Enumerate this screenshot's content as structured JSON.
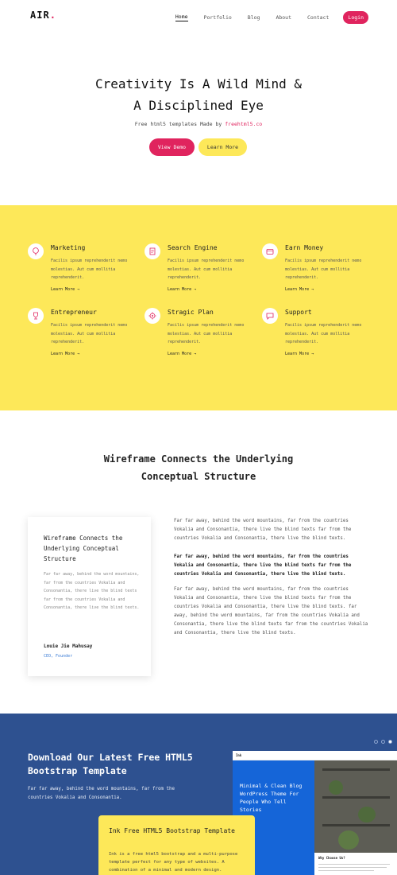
{
  "header": {
    "logo": "AIR",
    "logo_dot": ".",
    "nav": [
      "Home",
      "Portfolio",
      "Blog",
      "About",
      "Contact"
    ],
    "login": "Login"
  },
  "hero": {
    "title_line1": "Creativity Is A Wild Mind &",
    "title_line2": "A Disciplined Eye",
    "subtitle_prefix": "Free html5 templates Made by ",
    "subtitle_link": "freehtml5.co",
    "btn_demo": "View Demo",
    "btn_more": "Learn More"
  },
  "services": [
    {
      "title": "Marketing",
      "desc": "Facilis ipsum reprehenderit nemo molestias. Aut cum mollitia reprehenderit.",
      "link": "Learn More",
      "icon": "balloon-icon"
    },
    {
      "title": "Search Engine",
      "desc": "Facilis ipsum reprehenderit nemo molestias. Aut cum mollitia reprehenderit.",
      "link": "Learn More",
      "icon": "document-icon"
    },
    {
      "title": "Earn Money",
      "desc": "Facilis ipsum reprehenderit nemo molestias. Aut cum mollitia reprehenderit.",
      "link": "Learn More",
      "icon": "wallet-icon"
    },
    {
      "title": "Entrepreneur",
      "desc": "Facilis ipsum reprehenderit nemo molestias. Aut cum mollitia reprehenderit.",
      "link": "Learn More",
      "icon": "trophy-icon"
    },
    {
      "title": "Stragic Plan",
      "desc": "Facilis ipsum reprehenderit nemo molestias. Aut cum mollitia reprehenderit.",
      "link": "Learn More",
      "icon": "gear-icon"
    },
    {
      "title": "Support",
      "desc": "Facilis ipsum reprehenderit nemo molestias. Aut cum mollitia reprehenderit.",
      "link": "Learn More",
      "icon": "chat-icon"
    }
  ],
  "about": {
    "title_line1": "Wireframe Connects the Underlying",
    "title_line2": "Conceptual Structure",
    "card": {
      "title": "Wireframe Connects the Underlying Conceptual Structure",
      "text": "Far far away, behind the word mountains, far from the countries Vokalia and Consonantia, there live the blind texts far from the countries Vokalia and Consonantia, there live the blind texts.",
      "author": "Louie Jie Mahusay",
      "role": "CEO, Founder"
    },
    "paragraphs": [
      "Far far away, behind the word mountains, far from the countries Vokalia and Consonantia, there live the blind texts far from the countries Vokalia and Consonantia, there live the blind texts.",
      "Far far away, behind the word mountains, far from the countries Vokalia and Consonantia, there live the blind texts far from the countries Vokalia and Consonantia, there live the blind texts.",
      "Far far away, behind the word mountains, far from the countries Vokalia and Consonantia, there live the blind texts far from the countries Vokalia and Consonantia, there live the blind texts. far away, behind the word mountains, far from the countries Vokalia and Consonantia, there live the blind texts far from the countries Vokalia and Consonantia, there live the blind texts."
    ]
  },
  "download": {
    "title": "Download Our Latest Free HTML5 Bootstrap Template",
    "subtitle": "Far far away, behind the word mountains, far from the countries Vokalia and Consonantia.",
    "ink_title": "Ink Free HTML5 Bootstrap Template",
    "ink_text": "Ink is a free html5 bootstrap and a multi-purpose template perfect for any type of websites. A combination of a minimal and modern design.",
    "mock_logo": "Ink",
    "mock_text": "Minimal & Clean Blog WordPress Theme For People Who Tell Stories",
    "mock_why": "Why Choose Us?"
  },
  "colors": {
    "accent": "#e0245e",
    "yellow": "#fde859",
    "blue": "#2e5190"
  }
}
